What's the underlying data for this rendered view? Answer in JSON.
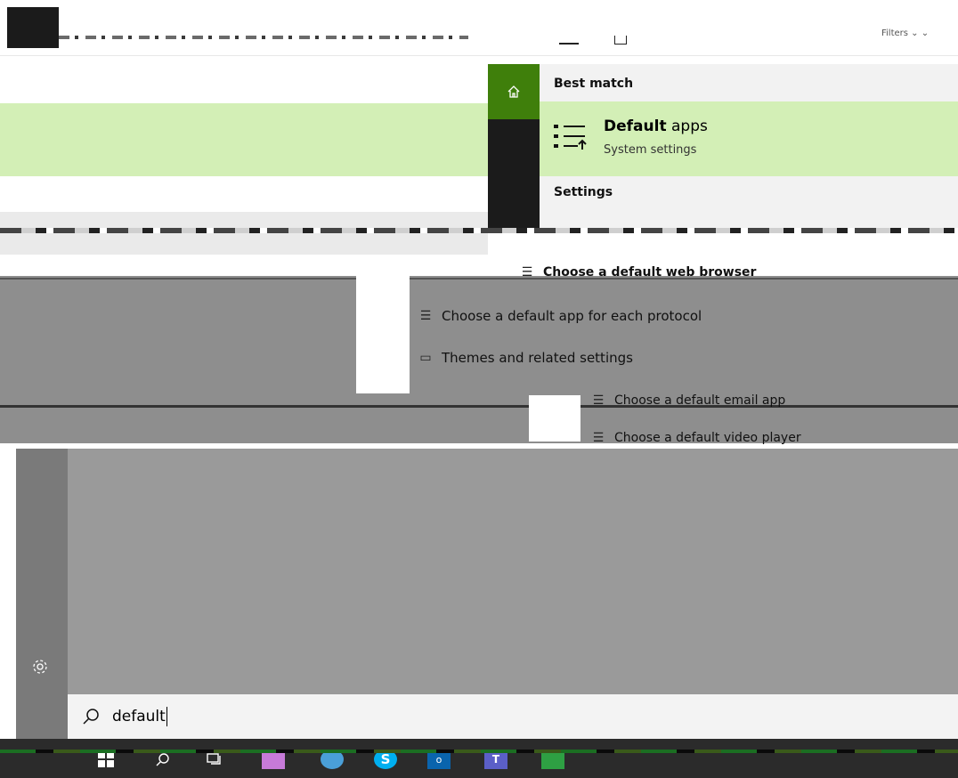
{
  "toolbar": {
    "filters_label": "Filters ⌄ ⌄"
  },
  "start_menu": {
    "best_match_header": "Best match",
    "best_match": {
      "title_bold": "Default",
      "title_rest": " apps",
      "subtitle": "System settings"
    },
    "settings_header": "Settings",
    "settings_items": [
      {
        "label": "Choose a default web browser"
      },
      {
        "label": "Choose a default app for each protocol"
      },
      {
        "label": "Themes and related settings"
      },
      {
        "label": "Choose a default email app"
      },
      {
        "label": "Choose a default video player"
      }
    ]
  },
  "search": {
    "value": "default"
  },
  "icons": {
    "home": "home-icon",
    "default_apps": "default-apps-icon",
    "settings_gear": "gear-icon",
    "search": "search-icon",
    "windows_start": "windows-logo-icon"
  },
  "colors": {
    "accent_green": "#3f7f0b",
    "highlight_green": "#d3efb6",
    "rail_dark": "#1b1b1b",
    "panel_light": "#f2f2f2"
  }
}
